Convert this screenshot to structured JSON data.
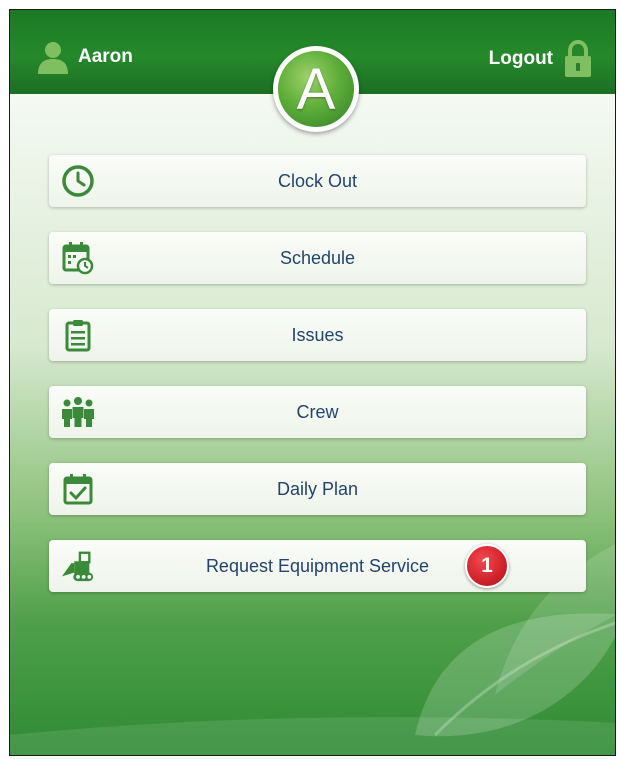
{
  "header": {
    "user_name": "Aaron",
    "logout_label": "Logout",
    "logo_letter": "A"
  },
  "menu": {
    "items": [
      {
        "label": "Clock Out",
        "icon": "clock-icon"
      },
      {
        "label": "Schedule",
        "icon": "calendar-clock-icon"
      },
      {
        "label": "Issues",
        "icon": "clipboard-icon"
      },
      {
        "label": "Crew",
        "icon": "people-group-icon"
      },
      {
        "label": "Daily Plan",
        "icon": "calendar-check-icon"
      },
      {
        "label": "Request Equipment Service",
        "icon": "loader-vehicle-icon",
        "badge": "1"
      }
    ]
  },
  "colors": {
    "header_green": "#1f7f26",
    "label_blue": "#23446e",
    "icon_green": "#3a8a3a",
    "badge_red": "#d0222b"
  }
}
